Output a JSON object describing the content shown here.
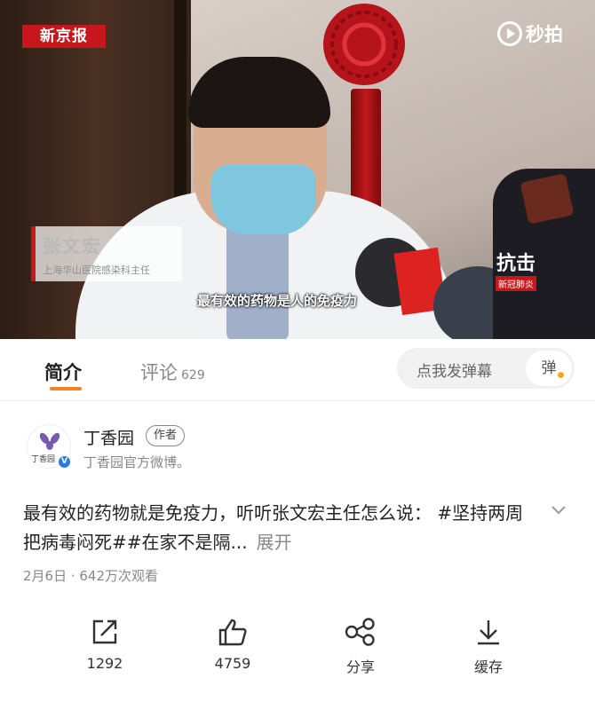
{
  "video": {
    "source_logo": "新京报",
    "platform_logo": "秒拍",
    "speaker_name": "张文宏",
    "speaker_title": "上海华山医院感染科主任",
    "subtitle": "最有效的药物是人的免疫力",
    "corner_badge_main": "抗击",
    "corner_badge_sub": "新冠肺炎"
  },
  "tabs": [
    {
      "label": "简介",
      "active": true
    },
    {
      "label": "评论",
      "count": "629",
      "active": false
    }
  ],
  "danmu": {
    "placeholder": "点我发弹幕",
    "button": "弹"
  },
  "author": {
    "name": "丁香园",
    "tag": "作者",
    "description": "丁香园官方微博。",
    "avatar_brand": "丁香园",
    "verified_icon": "verified-badge-icon"
  },
  "post": {
    "text": "最有效的药物就是免疫力，听听张文宏主任怎么说： #坚持两周把病毒闷死##在家不是隔...",
    "expand_label": "展开",
    "meta": "2月6日 · 642万次观看"
  },
  "actions": [
    {
      "icon": "share-out-icon",
      "label": "1292"
    },
    {
      "icon": "thumbs-up-icon",
      "label": "4759"
    },
    {
      "icon": "share-nodes-icon",
      "label": "分享"
    },
    {
      "icon": "download-icon",
      "label": "缓存"
    }
  ],
  "colors": {
    "accent": "#f58220",
    "brand_red": "#c8161d",
    "verified_blue": "#2b7ae0"
  }
}
